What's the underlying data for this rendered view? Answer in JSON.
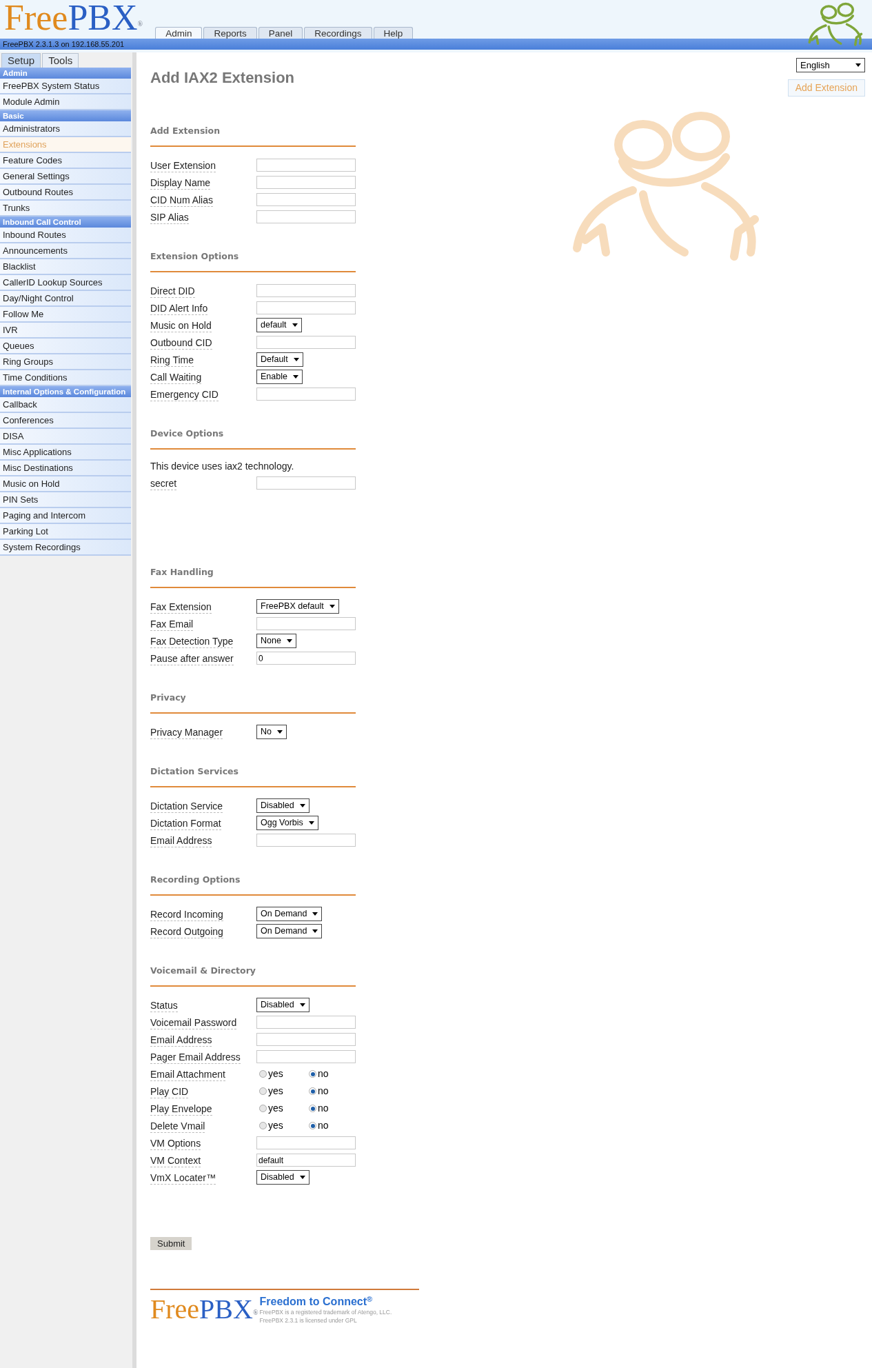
{
  "header": {
    "logo": {
      "first": "Free",
      "second": "PBX",
      "mark": "®"
    },
    "version": "FreePBX 2.3.1.3 on 192.168.55.201"
  },
  "nav_tabs": [
    {
      "label": "Admin",
      "selected": true
    },
    {
      "label": "Reports",
      "selected": false
    },
    {
      "label": "Panel",
      "selected": false
    },
    {
      "label": "Recordings",
      "selected": false
    },
    {
      "label": "Help",
      "selected": false
    }
  ],
  "sidebar": {
    "tabs": [
      {
        "label": "Setup",
        "selected": true
      },
      {
        "label": "Tools",
        "selected": false
      }
    ],
    "groups": [
      {
        "title": "Admin",
        "items": [
          {
            "label": "FreePBX System Status",
            "selected": false
          },
          {
            "label": "Module Admin",
            "selected": false
          }
        ]
      },
      {
        "title": "Basic",
        "items": [
          {
            "label": "Administrators",
            "selected": false
          },
          {
            "label": "Extensions",
            "selected": true
          },
          {
            "label": "Feature Codes",
            "selected": false
          },
          {
            "label": "General Settings",
            "selected": false
          },
          {
            "label": "Outbound Routes",
            "selected": false
          },
          {
            "label": "Trunks",
            "selected": false
          }
        ]
      },
      {
        "title": "Inbound Call Control",
        "items": [
          {
            "label": "Inbound Routes",
            "selected": false
          },
          {
            "label": "Announcements",
            "selected": false
          },
          {
            "label": "Blacklist",
            "selected": false
          },
          {
            "label": "CallerID Lookup Sources",
            "selected": false
          },
          {
            "label": "Day/Night Control",
            "selected": false
          },
          {
            "label": "Follow Me",
            "selected": false
          },
          {
            "label": "IVR",
            "selected": false
          },
          {
            "label": "Queues",
            "selected": false
          },
          {
            "label": "Ring Groups",
            "selected": false
          },
          {
            "label": "Time Conditions",
            "selected": false
          }
        ]
      },
      {
        "title": "Internal Options & Configuration",
        "items": [
          {
            "label": "Callback",
            "selected": false
          },
          {
            "label": "Conferences",
            "selected": false
          },
          {
            "label": "DISA",
            "selected": false
          },
          {
            "label": "Misc Applications",
            "selected": false
          },
          {
            "label": "Misc Destinations",
            "selected": false
          },
          {
            "label": "Music on Hold",
            "selected": false
          },
          {
            "label": "PIN Sets",
            "selected": false
          },
          {
            "label": "Paging and Intercom",
            "selected": false
          },
          {
            "label": "Parking Lot",
            "selected": false
          },
          {
            "label": "System Recordings",
            "selected": false
          }
        ]
      }
    ]
  },
  "language": "English",
  "page_title": "Add IAX2 Extension",
  "add_button": "Add Extension",
  "sections": [
    {
      "title": "Add Extension",
      "rows": [
        {
          "kind": "text",
          "label": "User Extension"
        },
        {
          "kind": "text",
          "label": "Display Name"
        },
        {
          "kind": "text",
          "label": "CID Num Alias"
        },
        {
          "kind": "text",
          "label": "SIP Alias"
        }
      ]
    },
    {
      "title": "Extension Options",
      "rows": [
        {
          "kind": "text",
          "label": "Direct DID"
        },
        {
          "kind": "text",
          "label": "DID Alert Info"
        },
        {
          "kind": "select",
          "label": "Music on Hold",
          "value": "default"
        },
        {
          "kind": "text",
          "label": "Outbound CID"
        },
        {
          "kind": "select",
          "label": "Ring Time",
          "value": "Default"
        },
        {
          "kind": "select",
          "label": "Call Waiting",
          "value": "Enable"
        },
        {
          "kind": "text",
          "label": "Emergency CID"
        }
      ]
    },
    {
      "title": "Device Options",
      "note": "This device uses iax2 technology.",
      "rows": [
        {
          "kind": "text",
          "label": "secret"
        }
      ]
    },
    {
      "title": "Fax Handling",
      "rows": [
        {
          "kind": "select",
          "label": "Fax Extension",
          "value": "FreePBX default"
        },
        {
          "kind": "text",
          "label": "Fax Email"
        },
        {
          "kind": "select",
          "label": "Fax Detection Type",
          "value": "None"
        },
        {
          "kind": "text",
          "label": "Pause after answer",
          "value": "0"
        }
      ]
    },
    {
      "title": "Privacy",
      "rows": [
        {
          "kind": "select",
          "label": "Privacy Manager",
          "value": "No"
        }
      ]
    },
    {
      "title": "Dictation Services",
      "rows": [
        {
          "kind": "select",
          "label": "Dictation Service",
          "value": "Disabled"
        },
        {
          "kind": "select",
          "label": "Dictation Format",
          "value": "Ogg Vorbis"
        },
        {
          "kind": "text",
          "label": "Email Address"
        }
      ]
    },
    {
      "title": "Recording Options",
      "rows": [
        {
          "kind": "select",
          "label": "Record Incoming",
          "value": "On Demand"
        },
        {
          "kind": "select",
          "label": "Record Outgoing",
          "value": "On Demand"
        }
      ]
    },
    {
      "title": "Voicemail & Directory",
      "rows": [
        {
          "kind": "select",
          "label": "Status",
          "value": "Disabled"
        },
        {
          "kind": "text",
          "label": "Voicemail Password"
        },
        {
          "kind": "text",
          "label": "Email Address"
        },
        {
          "kind": "text",
          "label": "Pager Email Address"
        },
        {
          "kind": "radio",
          "label": "Email Attachment",
          "options": [
            {
              "label": "yes",
              "selected": false
            },
            {
              "label": "no",
              "selected": true
            }
          ]
        },
        {
          "kind": "radio",
          "label": "Play CID",
          "options": [
            {
              "label": "yes",
              "selected": false
            },
            {
              "label": "no",
              "selected": true
            }
          ]
        },
        {
          "kind": "radio",
          "label": "Play Envelope",
          "options": [
            {
              "label": "yes",
              "selected": false
            },
            {
              "label": "no",
              "selected": true
            }
          ]
        },
        {
          "kind": "radio",
          "label": "Delete Vmail",
          "options": [
            {
              "label": "yes",
              "selected": false
            },
            {
              "label": "no",
              "selected": true
            }
          ]
        },
        {
          "kind": "text",
          "label": "VM Options"
        },
        {
          "kind": "text",
          "label": "VM Context",
          "value": "default"
        },
        {
          "kind": "select",
          "label": "VmX Locater™",
          "value": "Disabled"
        }
      ]
    }
  ],
  "submit": "Submit",
  "footer": {
    "logo": {
      "first": "Free",
      "second": "PBX",
      "mark": "®"
    },
    "slogan": "Freedom to Connect",
    "slogan_mark": "®",
    "lines": [
      "FreePBX is a registered trademark of Atengo, LLC.",
      "FreePBX 2.3.1 is licensed under GPL"
    ]
  }
}
